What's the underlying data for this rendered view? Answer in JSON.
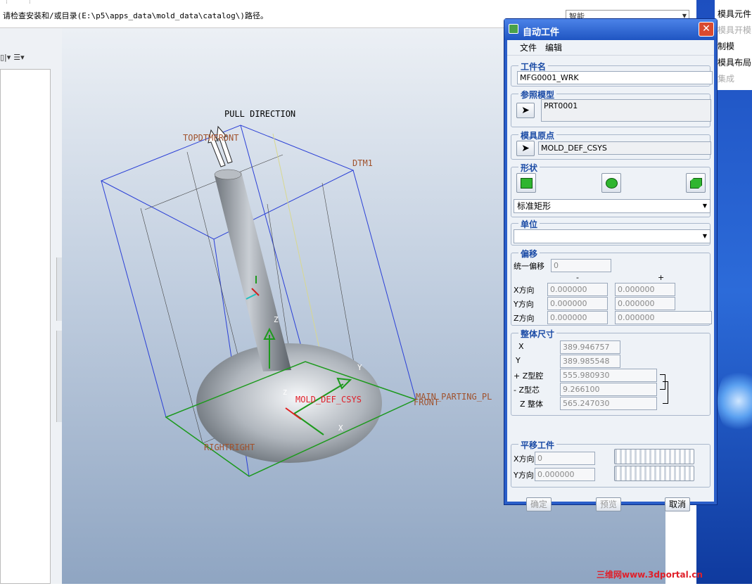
{
  "message_bar": {
    "text": "请检查安装和/或目录(E:\\p5\\apps_data\\mold_data\\catalog\\)路径。",
    "filter_value": "智能"
  },
  "viewport": {
    "labels": [
      "PULL DIRECTION",
      "TOPDTMFRONT",
      "DTM1",
      "MOLD_DEF_CSYS",
      "MAIN_PARTING_PL",
      "FRONT",
      "RIGHTRIGHT",
      "Z",
      "Y",
      "X",
      "Z"
    ]
  },
  "right_menu": {
    "items": [
      {
        "label": "模具元件",
        "enabled": true
      },
      {
        "label": "模具开模",
        "enabled": false
      },
      {
        "label": "制模",
        "enabled": true
      },
      {
        "label": "模具布局",
        "enabled": true
      },
      {
        "label": "集成",
        "enabled": false
      }
    ]
  },
  "watermark": "三维网www.3dportal.cn",
  "dialog": {
    "title": "自动工件",
    "menu": [
      "文件",
      "编辑"
    ],
    "workpiece_name": {
      "title": "工件名",
      "value": "MFG0001_WRK"
    },
    "ref_model": {
      "title": "参照模型",
      "value": "PRT0001"
    },
    "mold_origin": {
      "title": "模具原点",
      "value": "MOLD_DEF_CSYS"
    },
    "shape": {
      "title": "形状",
      "selected": "标准矩形"
    },
    "unit": {
      "title": "单位",
      "selected": ""
    },
    "offset": {
      "title": "偏移",
      "uniform_label": "统一偏移",
      "uniform_value": "0",
      "minus": "-",
      "plus": "+",
      "rows": [
        {
          "label": "X方向",
          "minus": "0.000000",
          "plus": "0.000000"
        },
        {
          "label": "Y方向",
          "minus": "0.000000",
          "plus": "0.000000"
        },
        {
          "label": "Z方向",
          "minus": "0.000000",
          "plus": "0.000000"
        }
      ]
    },
    "overall": {
      "title": "整体尺寸",
      "x_label": "X",
      "x": "389.946757",
      "y_label": "Y",
      "y": "389.985548",
      "zplus_label": "+ Z型腔",
      "zplus": "555.980930",
      "zminus_label": "- Z型芯",
      "zminus": "9.266100",
      "ztotal_label": "Z 整体",
      "ztotal": "565.247030"
    },
    "translate": {
      "title": "平移工件",
      "x_label": "X方向",
      "x": "0",
      "y_label": "Y方向",
      "y": "0.000000"
    },
    "buttons": {
      "ok": "确定",
      "preview": "预览",
      "cancel": "取消"
    }
  }
}
